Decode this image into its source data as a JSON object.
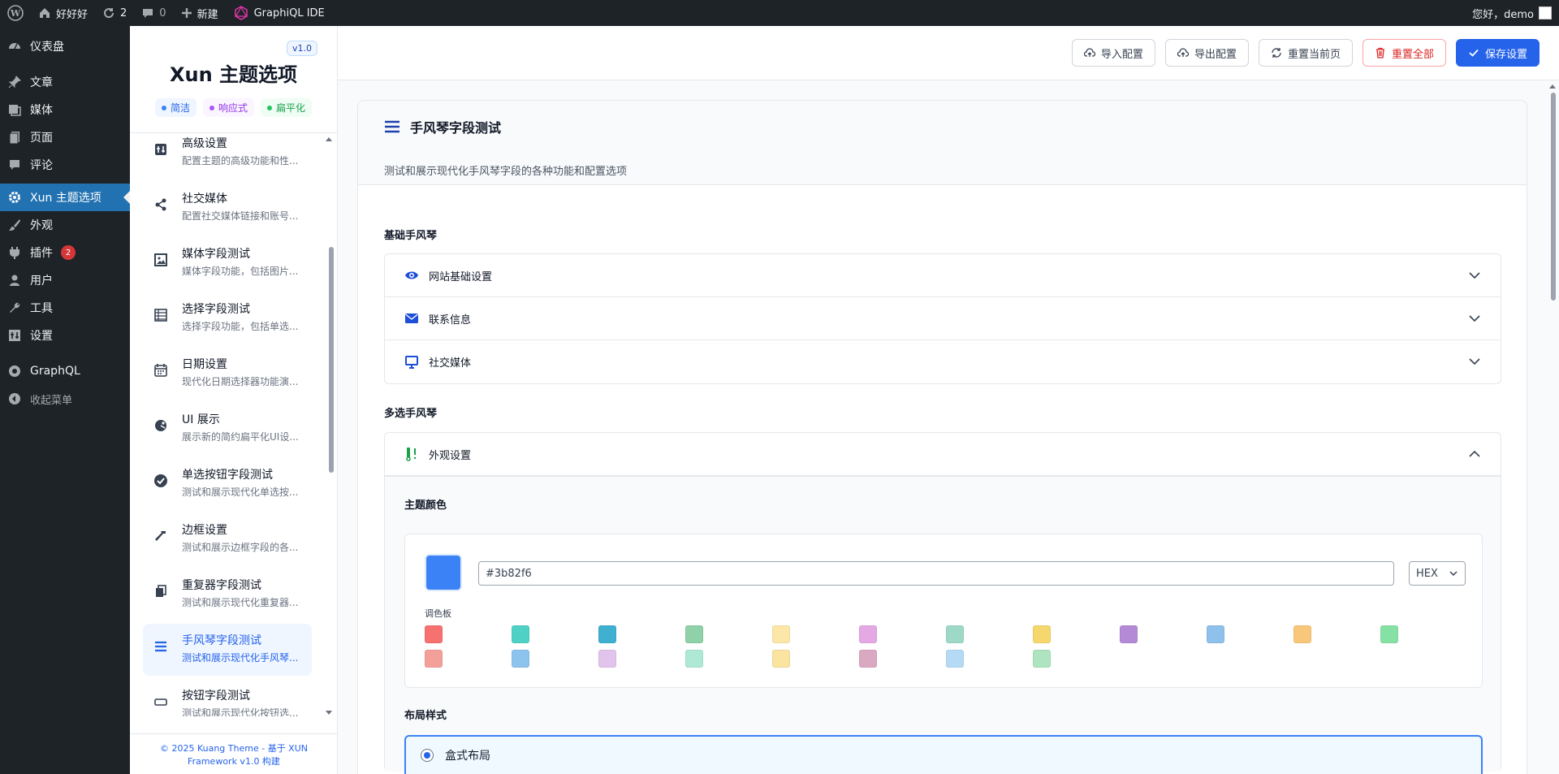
{
  "adminbar": {
    "site_name": "好好好",
    "updates_count": "2",
    "comments_count": "0",
    "new_label": "新建",
    "graphiql_label": "GraphiQL IDE",
    "greeting": "您好，demo"
  },
  "adminmenu": {
    "items": [
      {
        "label": "仪表盘",
        "icon": "dashboard-icon"
      },
      {
        "label": "文章",
        "icon": "pin-icon"
      },
      {
        "label": "媒体",
        "icon": "media-icon"
      },
      {
        "label": "页面",
        "icon": "page-icon"
      },
      {
        "label": "评论",
        "icon": "comment-icon"
      },
      {
        "label": "Xun 主题选项",
        "icon": "gear-icon"
      },
      {
        "label": "外观",
        "icon": "brush-icon"
      },
      {
        "label": "插件",
        "icon": "plugin-icon",
        "badge": "2"
      },
      {
        "label": "用户",
        "icon": "user-icon"
      },
      {
        "label": "工具",
        "icon": "wrench-icon"
      },
      {
        "label": "设置",
        "icon": "settings-icon"
      },
      {
        "label": "GraphQL",
        "icon": "graphql-icon"
      },
      {
        "label": "收起菜单",
        "icon": "collapse-icon"
      }
    ]
  },
  "optnav": {
    "version": "v1.0",
    "title": "Xun 主题选项",
    "tags": [
      {
        "label": "简洁",
        "color": "#2563eb",
        "bg": "#eff6ff"
      },
      {
        "label": "响应式",
        "color": "#9333ea",
        "bg": "#faf5ff"
      },
      {
        "label": "扁平化",
        "color": "#16a34a",
        "bg": "#f0fdf4"
      }
    ],
    "items": [
      {
        "title": "高级设置",
        "desc": "配置主题的高级功能和性...",
        "icon": "advanced-icon"
      },
      {
        "title": "社交媒体",
        "desc": "配置社交媒体链接和账号...",
        "icon": "share-icon"
      },
      {
        "title": "媒体字段测试",
        "desc": "媒体字段功能，包括图片...",
        "icon": "image-icon"
      },
      {
        "title": "选择字段测试",
        "desc": "选择字段功能，包括单选...",
        "icon": "list-icon"
      },
      {
        "title": "日期设置",
        "desc": "现代化日期选择器功能演...",
        "icon": "calendar-icon"
      },
      {
        "title": "UI 展示",
        "desc": "展示新的简约扁平化UI设...",
        "icon": "palette-icon"
      },
      {
        "title": "单选按钮字段测试",
        "desc": "测试和展示现代化单选按...",
        "icon": "check-circle-icon"
      },
      {
        "title": "边框设置",
        "desc": "测试和展示边框字段的各...",
        "icon": "hammer-icon"
      },
      {
        "title": "重复器字段测试",
        "desc": "测试和展示现代化重复器...",
        "icon": "copy-icon"
      },
      {
        "title": "手风琴字段测试",
        "desc": "测试和展示现代化手风琴...",
        "icon": "menu-icon",
        "active": true
      },
      {
        "title": "按钮字段测试",
        "desc": "测试和展示现代化按钮选...",
        "icon": "button-icon"
      }
    ],
    "footer_line1": "© 2025 Kuang Theme - 基于 XUN",
    "footer_line2": "Framework v1.0 构建"
  },
  "toolbar": {
    "import_label": "导入配置",
    "export_label": "导出配置",
    "reset_page_label": "重置当前页",
    "reset_all_label": "重置全部",
    "save_label": "保存设置"
  },
  "section": {
    "title": "手风琴字段测试",
    "description": "测试和展示现代化手风琴字段的各种功能和配置选项",
    "basic_label": "基础手风琴",
    "basic_items": [
      {
        "label": "网站基础设置",
        "icon": "eye-icon"
      },
      {
        "label": "联系信息",
        "icon": "envelope-icon"
      },
      {
        "label": "社交媒体",
        "icon": "monitor-icon"
      }
    ],
    "multi_label": "多选手风琴",
    "multi_item": {
      "label": "外观设置",
      "icon": "paint-icon"
    },
    "theme_color_label": "主题颜色",
    "color_value": "#3b82f6",
    "color_format": "HEX",
    "palette_label": "调色板",
    "palette": [
      "#f87171",
      "#4fd1c5",
      "#3fb0d0",
      "#8fd1a8",
      "#fce7a8",
      "#e4a9e4",
      "#9ed9c8",
      "#f5d76e",
      "#b48ad6",
      "#8ec1ec",
      "#f8c77a",
      "#86e2a4",
      "#f4a09a",
      "#8cc4ee",
      "#e2c3ec",
      "#aee9d6",
      "#fbe3a0",
      "#dba8c2",
      "#b5daf5",
      "#aee4c0"
    ],
    "layout_label": "布局样式",
    "layout_option": "盒式布局"
  }
}
